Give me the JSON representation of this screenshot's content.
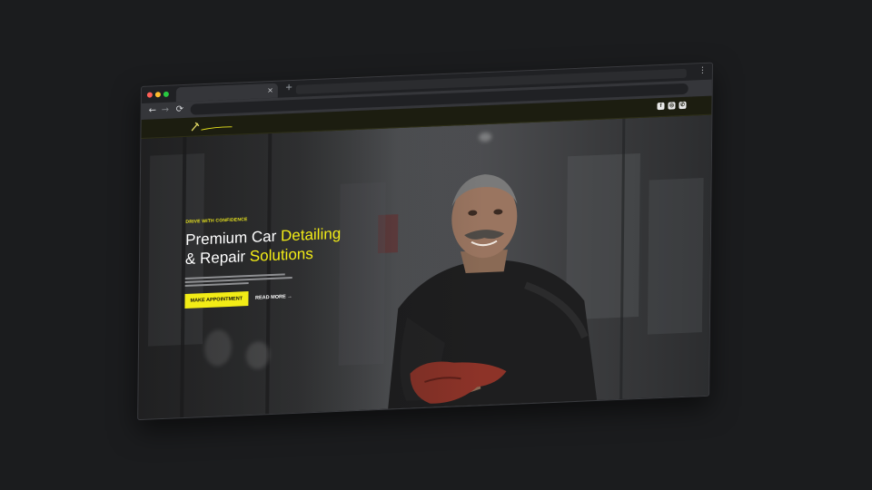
{
  "browser": {
    "tab_close": "×",
    "new_tab": "+",
    "menu": "⋮",
    "nav": {
      "back": "←",
      "forward": "→",
      "reload": "⟳"
    }
  },
  "header": {
    "social": [
      {
        "icon": "facebook-icon",
        "glyph": "f"
      },
      {
        "icon": "instagram-icon",
        "glyph": "◎"
      },
      {
        "icon": "whatsapp-icon",
        "glyph": "✆"
      }
    ]
  },
  "hero": {
    "eyebrow": "DRIVE WITH CONFIDENCE",
    "title_line1_a": "Premium Car ",
    "title_line1_b": "Detailing",
    "title_line2_a": "& Repair ",
    "title_line2_b": "Solutions",
    "cta_primary": "MAKE APPOINTMENT",
    "cta_secondary": "READ MORE →"
  },
  "colors": {
    "accent": "#f2ec16",
    "header_bg": "#1c1d10",
    "page_bg": "#1b1c1e"
  }
}
